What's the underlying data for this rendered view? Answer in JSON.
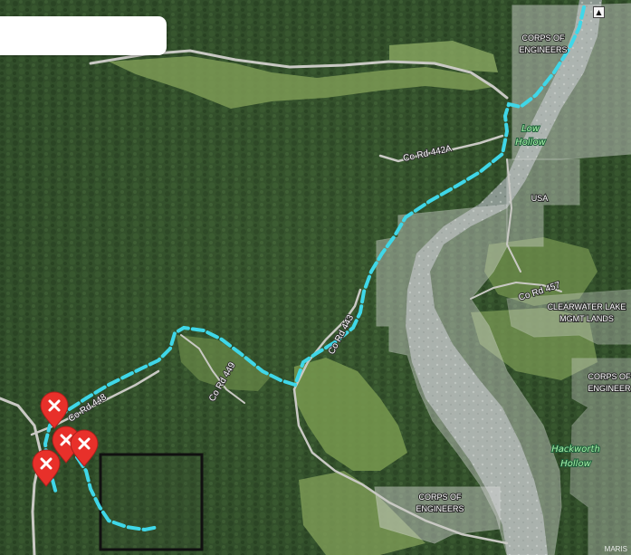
{
  "map": {
    "attribution": "MARIS",
    "land_labels": {
      "corps_top": [
        "CORPS OF",
        "ENGINEERS"
      ],
      "usa": "USA",
      "clearwater": [
        "CLEARWATER LAKE",
        "MGMT LANDS"
      ],
      "corps_right": [
        "CORPS OF",
        "ENGINEER"
      ],
      "corps_bottom": [
        "CORPS OF",
        "ENGINEERS"
      ]
    },
    "place_labels": {
      "low_hollow": [
        "Low",
        "Hollow"
      ],
      "hackworth_hollow": [
        "Hackworth",
        "Hollow"
      ]
    },
    "road_labels": {
      "rd_442a": "Co Rd 442A",
      "rd_443": "Co Rd 443",
      "rd_449": "Co Rd 449",
      "rd_448": "Co Rd 448",
      "rd_457": "Co Rd 457"
    },
    "markers": [
      {
        "icon": "close-icon"
      },
      {
        "icon": "close-icon"
      },
      {
        "icon": "close-icon"
      },
      {
        "icon": "close-icon"
      }
    ],
    "colors": {
      "route": "#3fd7e8",
      "marker": "#e8302a",
      "parcel_outline": "#111111",
      "public_land": "#dcdcdc"
    }
  }
}
